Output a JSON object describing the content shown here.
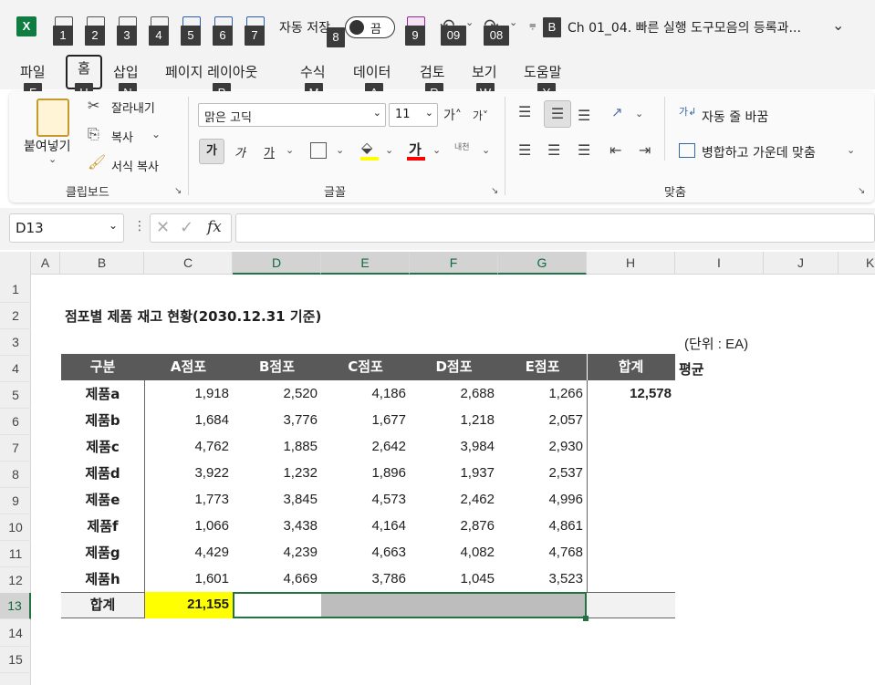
{
  "titlebar": {
    "autosave_label": "자동 저장",
    "toggle_state": "끔",
    "doc_title": "Ch 01_04. 빠른 실행 도구모음의 등록과...",
    "keytips": [
      "1",
      "2",
      "3",
      "4",
      "5",
      "6",
      "7",
      "8",
      "9",
      "09",
      "08",
      "B"
    ]
  },
  "menu": {
    "tabs": [
      "파일",
      "홈",
      "삽입",
      "페이지 레이아웃",
      "수식",
      "데이터",
      "검토",
      "보기",
      "도움말"
    ],
    "keytips": [
      "F",
      "H",
      "N",
      "P",
      "M",
      "A",
      "R",
      "W",
      "Y"
    ]
  },
  "ribbon": {
    "clipboard": {
      "paste": "붙여넣기",
      "cut": "잘라내기",
      "copy": "복사",
      "format_painter": "서식 복사",
      "group_label": "클립보드"
    },
    "font": {
      "font_name": "맑은 고딕",
      "font_size": "11",
      "bold": "가",
      "italic": "가",
      "underline": "가",
      "group_label": "글꼴",
      "fill_color": "#ffff00",
      "font_color": "#ff0000"
    },
    "alignment": {
      "wrap_text": "자동 줄 바꿈",
      "merge_center": "병합하고 가운데 맞춤",
      "group_label": "맞춤"
    }
  },
  "formula_bar": {
    "name_box": "D13",
    "fx": "fx",
    "formula": ""
  },
  "grid": {
    "columns": [
      "A",
      "B",
      "C",
      "D",
      "E",
      "F",
      "G",
      "H",
      "I",
      "J",
      "K"
    ],
    "rows": [
      "1",
      "2",
      "3",
      "4",
      "5",
      "6",
      "7",
      "8",
      "9",
      "10",
      "11",
      "12",
      "13",
      "14",
      "15"
    ],
    "selected_cell": "D13"
  },
  "sheet": {
    "title": "점포별 제품 재고 현황(2030.12.31 기준)",
    "unit": "(단위 : EA)",
    "headers": [
      "구분",
      "A점포",
      "B점포",
      "C점포",
      "D점포",
      "E점포",
      "합계"
    ],
    "extra_header": "평균",
    "rows": [
      {
        "label": "제품a",
        "values": [
          "1,918",
          "2,520",
          "4,186",
          "2,688",
          "1,266"
        ],
        "total": "12,578"
      },
      {
        "label": "제품b",
        "values": [
          "1,684",
          "3,776",
          "1,677",
          "1,218",
          "2,057"
        ],
        "total": ""
      },
      {
        "label": "제품c",
        "values": [
          "4,762",
          "1,885",
          "2,642",
          "3,984",
          "2,930"
        ],
        "total": ""
      },
      {
        "label": "제품d",
        "values": [
          "3,922",
          "1,232",
          "1,896",
          "1,937",
          "2,537"
        ],
        "total": ""
      },
      {
        "label": "제품e",
        "values": [
          "1,773",
          "3,845",
          "4,573",
          "2,462",
          "4,996"
        ],
        "total": ""
      },
      {
        "label": "제품f",
        "values": [
          "1,066",
          "3,438",
          "4,164",
          "2,876",
          "4,861"
        ],
        "total": ""
      },
      {
        "label": "제품g",
        "values": [
          "4,429",
          "4,239",
          "4,663",
          "4,082",
          "4,768"
        ],
        "total": ""
      },
      {
        "label": "제품h",
        "values": [
          "1,601",
          "4,669",
          "3,786",
          "1,045",
          "3,523"
        ],
        "total": ""
      }
    ],
    "sum_label": "합계",
    "sum_values": [
      "21,155",
      "",
      "",
      "",
      ""
    ],
    "highlight_color": "#ffff00",
    "header_bg": "#595959"
  }
}
